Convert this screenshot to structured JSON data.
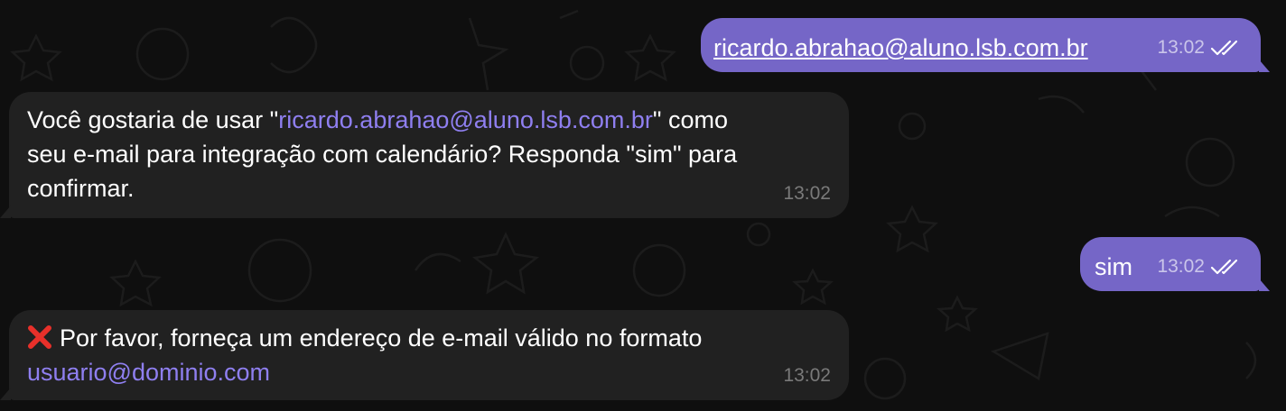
{
  "messages": [
    {
      "direction": "outgoing",
      "email": "ricardo.abrahao@aluno.lsb.com.br",
      "time": "13:02",
      "status_icon": "double-check-icon"
    },
    {
      "direction": "incoming",
      "text_part1": "Você gostaria de usar \"",
      "email_link": "ricardo.abrahao@aluno.lsb.com.br",
      "text_part2": "\" como",
      "line2": "seu e-mail para integração com calendário? Responda \"sim\" para",
      "line3": "confirmar.",
      "time": "13:02"
    },
    {
      "direction": "outgoing",
      "text": "sim",
      "time": "13:02",
      "status_icon": "double-check-icon"
    },
    {
      "direction": "incoming",
      "icon": "red-cross-icon",
      "line1": "Por favor, forneça um endereço de e-mail válido no formato",
      "email_link": "usuario@dominio.com",
      "time": "13:02"
    }
  ],
  "colors": {
    "background": "#0f0f0f",
    "incoming_bubble": "#212121",
    "outgoing_bubble": "#7566c7",
    "link": "#8f7ff0",
    "timestamp_incoming": "#7a7a7a"
  }
}
